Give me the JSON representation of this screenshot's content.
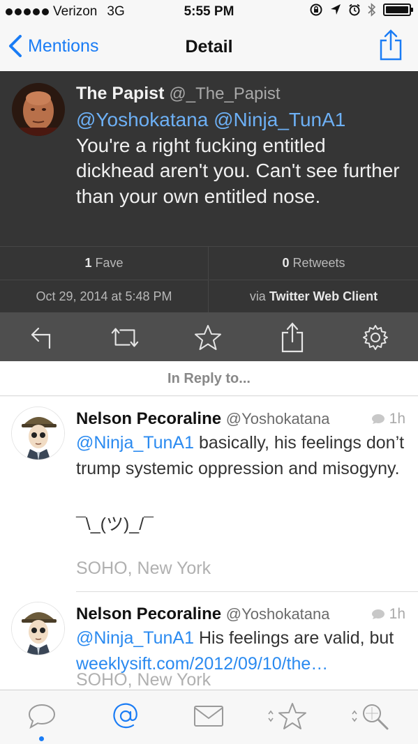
{
  "status_bar": {
    "carrier": "Verizon",
    "network": "3G",
    "time": "5:55 PM"
  },
  "nav": {
    "back_label": "Mentions",
    "title": "Detail"
  },
  "main_tweet": {
    "name": "The Papist",
    "handle": "@_The_Papist",
    "mentions": "@Yoshokatana @Ninja_TunA1",
    "text": "You're a right fucking entitled dickhead aren't you. Can't see further than your own entitled nose.",
    "faves_count": "1",
    "faves_label": "Fave",
    "retweets_count": "0",
    "retweets_label": "Retweets",
    "date": "Oct 29, 2014 at 5:48 PM",
    "via_label": "via",
    "client": "Twitter Web Client"
  },
  "reply_header": "In Reply to...",
  "replies": [
    {
      "name": "Nelson Pecoraline",
      "handle": "@Yoshokatana",
      "time": "1h",
      "mention": "@Ninja_TunA1",
      "text": "basically, his feelings don’t trump systemic oppression and misogyny.",
      "shrug": "¯\\_(ツ)_/¯",
      "location": "SOHO, New York"
    },
    {
      "name": "Nelson Pecoraline",
      "handle": "@Yoshokatana",
      "time": "1h",
      "mention": "@Ninja_TunA1",
      "text": "His feelings are valid, but",
      "link": "weeklysift.com/2012/09/10/the…",
      "location": "SOHO, New York"
    }
  ],
  "tab_bar": {
    "items": [
      "timeline-icon",
      "mentions-icon",
      "messages-icon",
      "favorites-icon",
      "search-icon"
    ],
    "active": "mentions-icon"
  },
  "colors": {
    "accent": "#1a7cf5",
    "dark_bg": "#353535",
    "action_bar": "#4e4e4e",
    "mention_dark": "#6db0f5",
    "link": "#2a8af0"
  }
}
